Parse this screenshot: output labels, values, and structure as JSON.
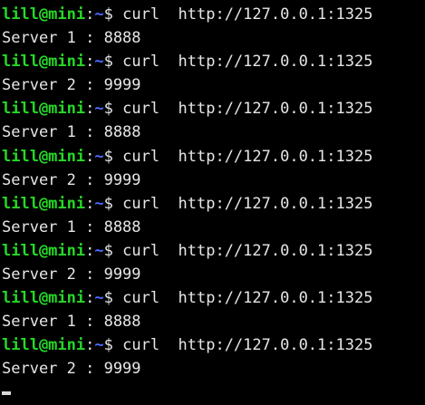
{
  "terminal": {
    "lines": [
      {
        "kind": "prompt",
        "user": "lill@mini",
        "sep": ":",
        "path": "~",
        "sigil": "$",
        "command": " curl  http://127.0.0.1:1325"
      },
      {
        "kind": "output",
        "text": "Server 1 : 8888"
      },
      {
        "kind": "prompt",
        "user": "lill@mini",
        "sep": ":",
        "path": "~",
        "sigil": "$",
        "command": " curl  http://127.0.0.1:1325"
      },
      {
        "kind": "output",
        "text": "Server 2 : 9999"
      },
      {
        "kind": "prompt",
        "user": "lill@mini",
        "sep": ":",
        "path": "~",
        "sigil": "$",
        "command": " curl  http://127.0.0.1:1325"
      },
      {
        "kind": "output",
        "text": "Server 1 : 8888"
      },
      {
        "kind": "prompt",
        "user": "lill@mini",
        "sep": ":",
        "path": "~",
        "sigil": "$",
        "command": " curl  http://127.0.0.1:1325"
      },
      {
        "kind": "output",
        "text": "Server 2 : 9999"
      },
      {
        "kind": "prompt",
        "user": "lill@mini",
        "sep": ":",
        "path": "~",
        "sigil": "$",
        "command": " curl  http://127.0.0.1:1325"
      },
      {
        "kind": "output",
        "text": "Server 1 : 8888"
      },
      {
        "kind": "prompt",
        "user": "lill@mini",
        "sep": ":",
        "path": "~",
        "sigil": "$",
        "command": " curl  http://127.0.0.1:1325"
      },
      {
        "kind": "output",
        "text": "Server 2 : 9999"
      },
      {
        "kind": "prompt",
        "user": "lill@mini",
        "sep": ":",
        "path": "~",
        "sigil": "$",
        "command": " curl  http://127.0.0.1:1325"
      },
      {
        "kind": "output",
        "text": "Server 1 : 8888"
      },
      {
        "kind": "prompt",
        "user": "lill@mini",
        "sep": ":",
        "path": "~",
        "sigil": "$",
        "command": " curl  http://127.0.0.1:1325"
      },
      {
        "kind": "output",
        "text": "Server 2 : 9999"
      }
    ],
    "cursor_visible": true
  },
  "colors": {
    "background": "#000000",
    "foreground": "#e6e6e6",
    "prompt_user": "#26d926",
    "prompt_path": "#4c6dff"
  }
}
